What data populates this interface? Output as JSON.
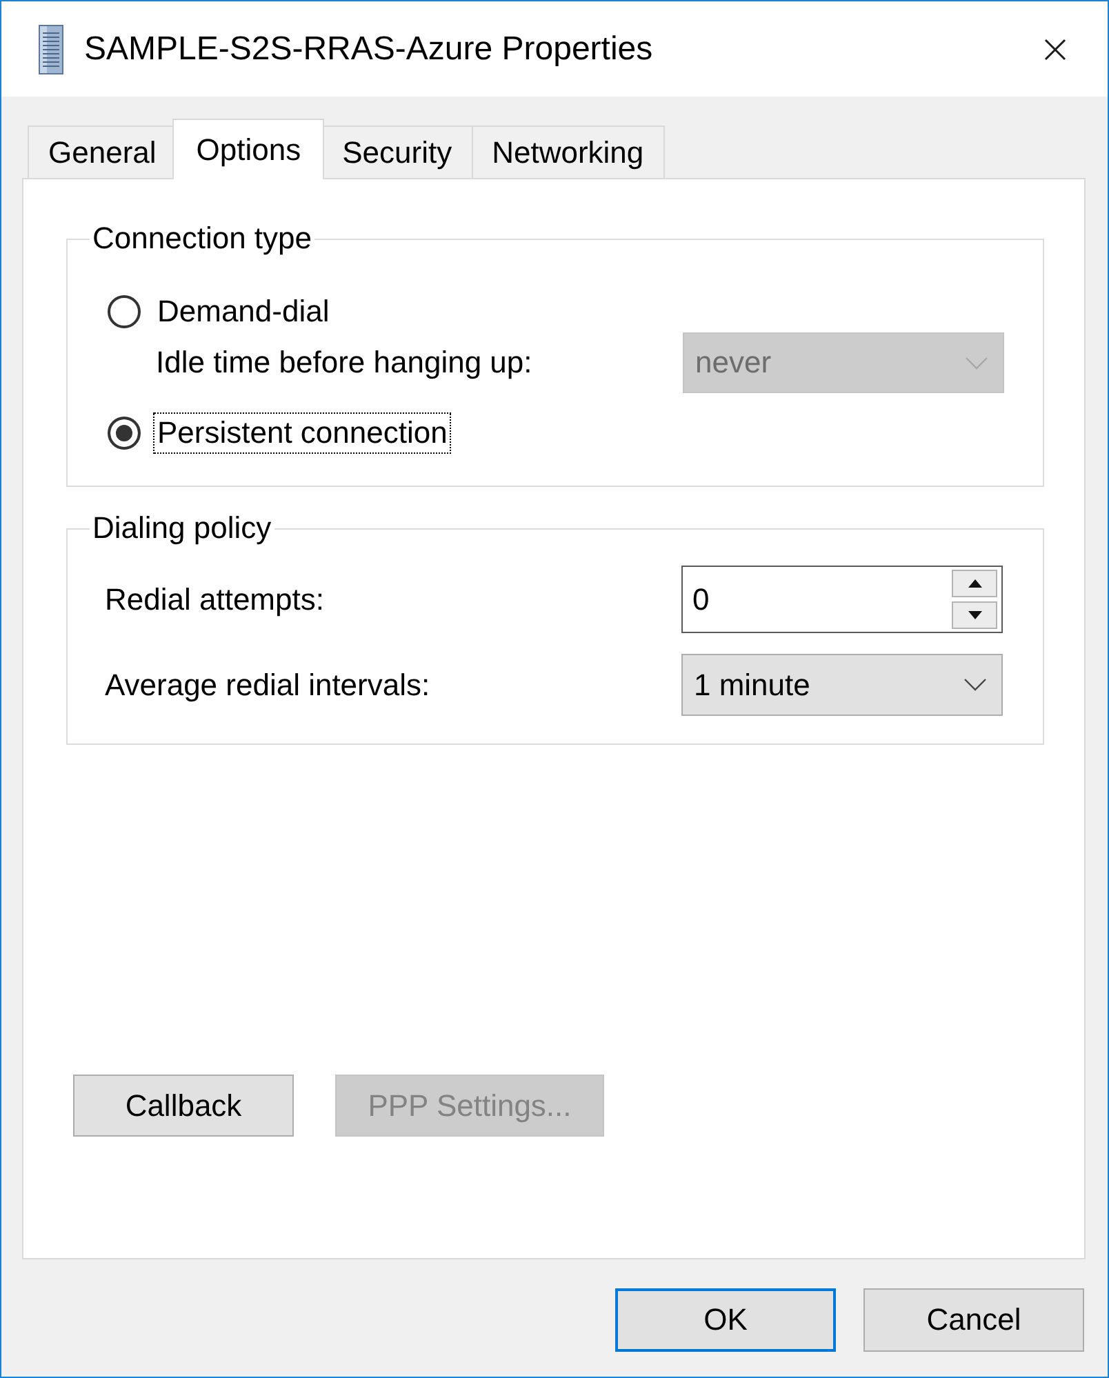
{
  "window": {
    "title": "SAMPLE-S2S-RRAS-Azure Properties"
  },
  "tabs": [
    {
      "label": "General",
      "selected": false
    },
    {
      "label": "Options",
      "selected": true
    },
    {
      "label": "Security",
      "selected": false
    },
    {
      "label": "Networking",
      "selected": false
    }
  ],
  "connection_type": {
    "legend": "Connection type",
    "options": [
      {
        "label": "Demand-dial",
        "selected": false,
        "focused": false,
        "setting": {
          "label": "Idle time before hanging up:",
          "value": "never",
          "disabled": true
        }
      },
      {
        "label": "Persistent connection",
        "selected": true,
        "focused": true
      }
    ]
  },
  "dialing_policy": {
    "legend": "Dialing policy",
    "fields": [
      {
        "kind": "spinner",
        "label": "Redial attempts:",
        "value": "0"
      },
      {
        "kind": "dropdown",
        "label": "Average redial intervals:",
        "value": "1 minute",
        "disabled": false
      }
    ]
  },
  "buttons": [
    {
      "label": "Callback",
      "disabled": false
    },
    {
      "label": "PPP Settings...",
      "disabled": true
    }
  ],
  "footer_buttons": [
    {
      "label": "OK",
      "default": true
    },
    {
      "label": "Cancel",
      "default": false
    }
  ]
}
